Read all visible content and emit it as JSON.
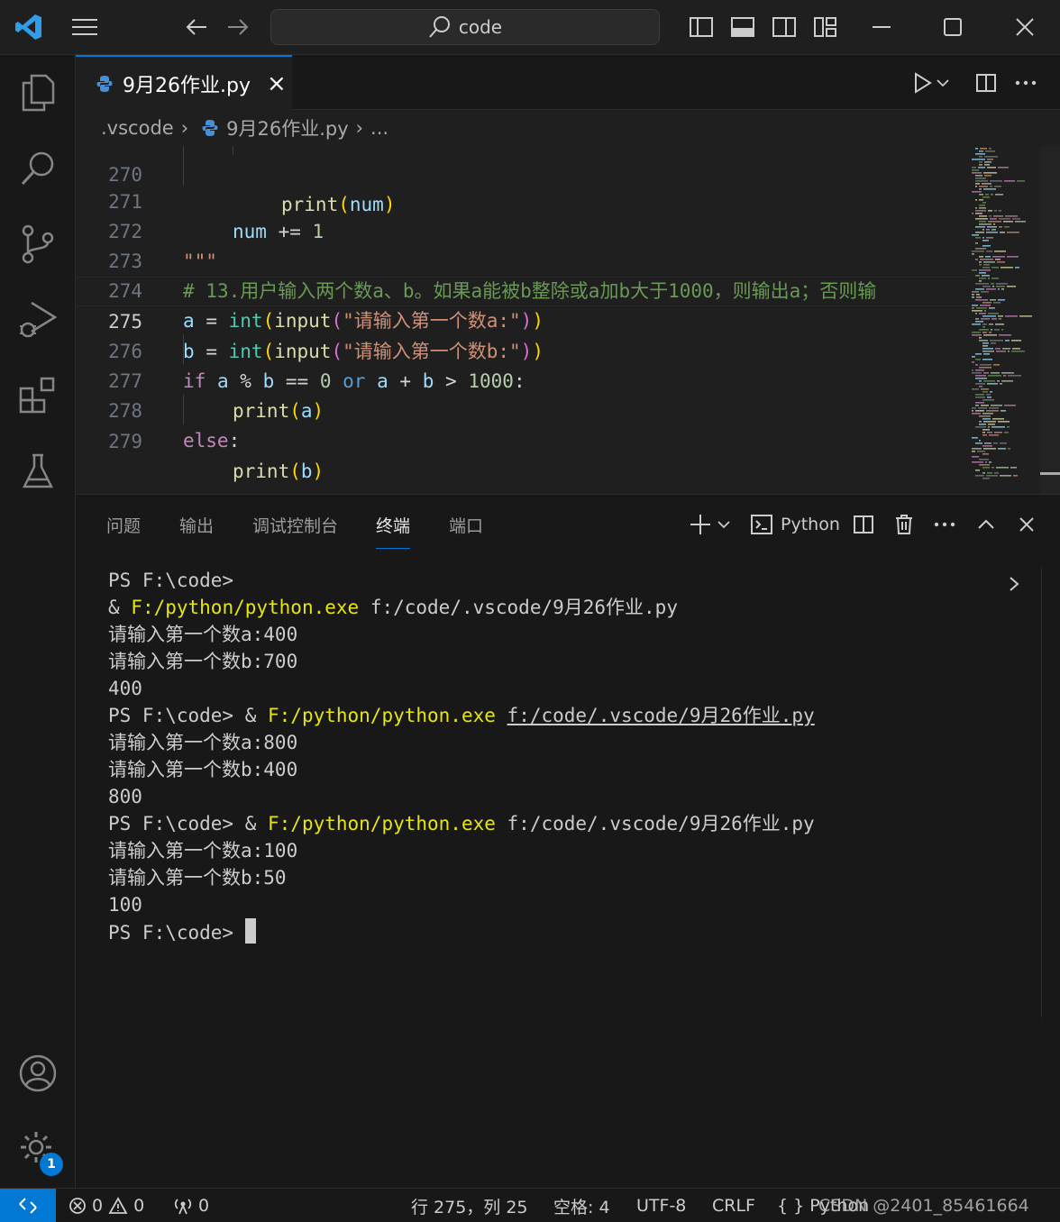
{
  "titlebar": {
    "search_text": "code",
    "icons": [
      "vscode-logo-icon",
      "menu-icon",
      "back-arrow-icon",
      "forward-arrow-icon",
      "search-icon",
      "toggle-primary-sidebar-icon",
      "toggle-panel-icon",
      "toggle-secondary-sidebar-icon",
      "customize-layout-icon",
      "minimize-icon",
      "maximize-icon",
      "close-icon"
    ]
  },
  "activity_bar": {
    "items": [
      "explorer-icon",
      "search-icon",
      "source-control-icon",
      "run-debug-icon",
      "extensions-icon",
      "testing-icon"
    ],
    "bottom": [
      "accounts-icon",
      "manage-gear-icon"
    ],
    "badge": "1"
  },
  "tab": {
    "label": "9月26作业.py",
    "close": "×"
  },
  "breadcrumb": {
    "folder": ".vscode",
    "file": "9月26作业.py",
    "more": "..."
  },
  "editor": {
    "lines": [
      {
        "n": "270",
        "text": "print(num)"
      },
      {
        "n": "271",
        "text": "num += 1"
      },
      {
        "n": "272",
        "text": "\"\"\""
      },
      {
        "n": "273",
        "text": "#  13.用户输入两个数a、b。如果a能被b整除或a加b大于1000，则输出a；否则输"
      },
      {
        "n": "274",
        "text": "a = int(input(\"请输入第一个数a:\"))"
      },
      {
        "n": "275",
        "text": "b = int(input(\"请输入第一个数b:\"))"
      },
      {
        "n": "276",
        "text": "if a % b == 0 or a + b > 1000:"
      },
      {
        "n": "277",
        "text": "print(a)"
      },
      {
        "n": "278",
        "text": "else:"
      },
      {
        "n": "279",
        "text": "print(b)"
      }
    ],
    "tokens": {
      "print": "print",
      "num": "num",
      "plus_eq": "+=",
      "one": "1",
      "triple_quote": "\"\"\"",
      "hash": "#",
      "comment": " 13.用户输入两个数a、b。如果a能被b整除或a加b大于1000，则输出a；否则输",
      "a": "a",
      "b": "b",
      "eq": "=",
      "int": "int",
      "input": "input",
      "lparen": "(",
      "rparen": ")",
      "str_a": "\"请输入第一个数a:\"",
      "str_b": "\"请输入第一个数b:\"",
      "if": "if",
      "mod": "%",
      "eqeq": "==",
      "zero": "0",
      "or": "or",
      "plus": "+",
      "gt": ">",
      "thousand": "1000",
      "colon": ":",
      "else": "else"
    }
  },
  "panel": {
    "tabs": [
      "问题",
      "输出",
      "调试控制台",
      "终端",
      "端口"
    ],
    "active_tab": "终端",
    "terminal_profile": "Python",
    "terminal_lines": {
      "l1": "PS F:\\code>",
      "l2_amp": "& ",
      "l2_exe": "F:/python/python.exe",
      "l2_file": " f:/code/.vscode/9月26作业.py",
      "l3": "请输入第一个数a:400",
      "l4": "请输入第一个数b:700",
      "l5": "400",
      "l6_ps": "PS F:\\code> & ",
      "l6_exe": "F:/python/python.exe",
      "l6_file": "f:/code/.vscode/9月26作业.py",
      "l7": "请输入第一个数a:800",
      "l8": "请输入第一个数b:400",
      "l9": "800",
      "l10_ps": "PS F:\\code> & ",
      "l10_exe": "F:/python/python.exe",
      "l10_file": " f:/code/.vscode/9月26作业.py",
      "l11": "请输入第一个数a:100",
      "l12": "请输入第一个数b:50",
      "l13": "100",
      "l14": "PS F:\\code> "
    }
  },
  "statusbar": {
    "errors": "0",
    "warnings": "0",
    "ports": "0",
    "position": "行 275，列 25",
    "spaces": "空格: 4",
    "encoding": "UTF-8",
    "eol": "CRLF",
    "language": "{ } Python",
    "watermark": "CSDN @2401_85461664"
  },
  "colors": {
    "accent": "#0078d4",
    "keyword": "#c586c0",
    "function": "#dcdcaa",
    "string": "#ce9178",
    "comment": "#6a9955",
    "terminal_yellow": "#e5e510"
  }
}
